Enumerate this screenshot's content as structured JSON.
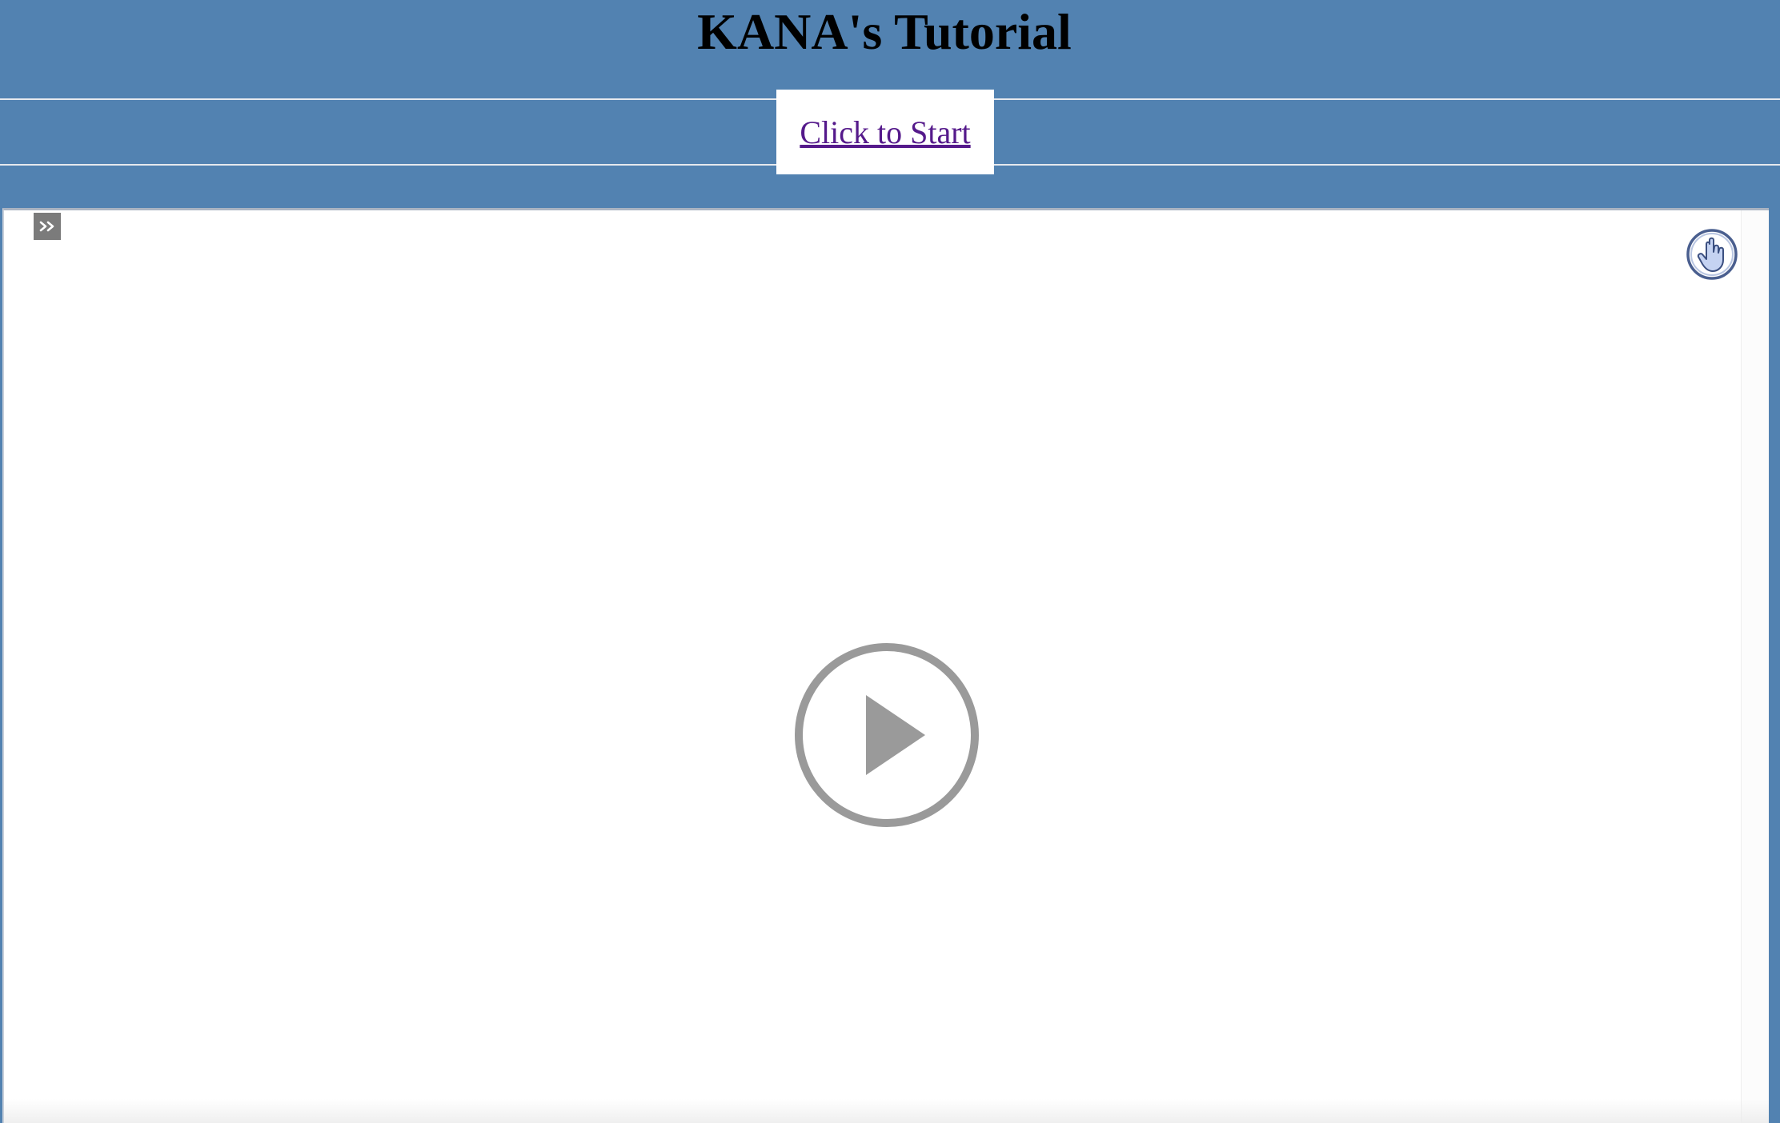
{
  "header": {
    "title": "KANA's Tutorial"
  },
  "start": {
    "label": "Click to Start"
  },
  "player": {
    "skip_icon": "double-chevron-right-icon",
    "hand_icon": "pointing-hand-icon",
    "play_icon": "play-circle-icon"
  },
  "colors": {
    "background": "#5282b1",
    "link": "#551a8b",
    "play_button": "#9a9a9a",
    "skip_button": "#7b7b7b"
  }
}
